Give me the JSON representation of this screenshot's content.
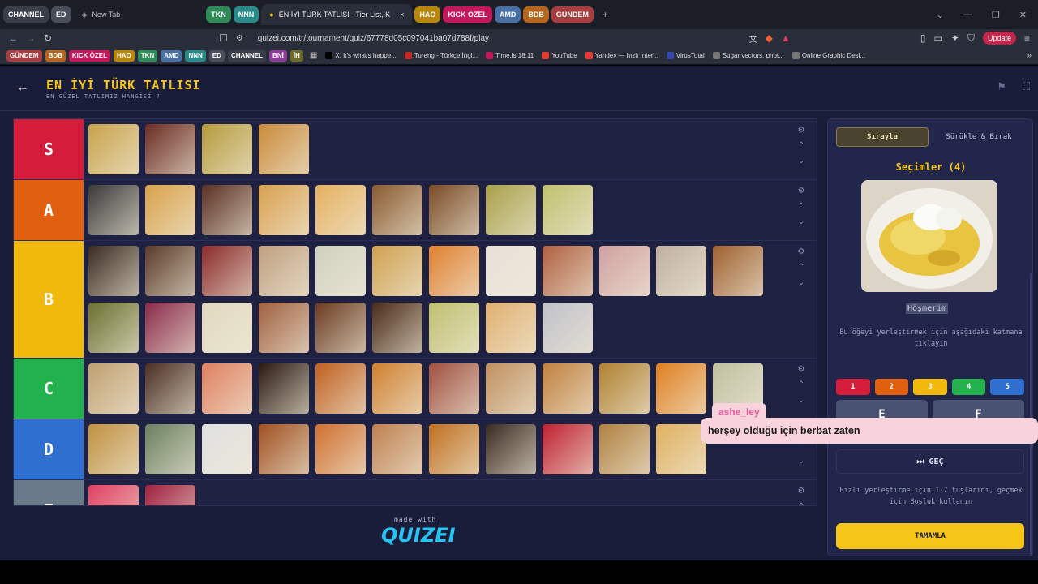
{
  "browser": {
    "tab_groups_left": [
      {
        "label": "CHANNEL",
        "color": "#3a3d4a"
      },
      {
        "label": "ED",
        "color": "#4a4d5a"
      }
    ],
    "new_tab_label": "New Tab",
    "tab_groups_mid": [
      {
        "label": "TKN",
        "color": "#2e8b57"
      },
      {
        "label": "NNN",
        "color": "#2a8a8a"
      }
    ],
    "active_tab": "EN İYİ TÜRK TATLISI - Tier List, K",
    "tab_groups_right": [
      {
        "label": "HAO",
        "color": "#b8860b"
      },
      {
        "label": "KICK ÖZEL",
        "color": "#c2185b"
      },
      {
        "label": "AMD",
        "color": "#4a6fa5"
      },
      {
        "label": "BDB",
        "color": "#b5651d"
      },
      {
        "label": "GÜNDEM",
        "color": "#a63d40"
      }
    ],
    "url": "quizei.com/tr/tournament/quiz/67778d05c097041ba07d788f/play",
    "update_label": "Update",
    "bookmark_chips": [
      {
        "label": "GÜNDEM",
        "color": "#a63d40"
      },
      {
        "label": "BDB",
        "color": "#b5651d"
      },
      {
        "label": "KICK ÖZEL",
        "color": "#c2185b"
      },
      {
        "label": "HAO",
        "color": "#b8860b"
      },
      {
        "label": "TKN",
        "color": "#2e8b57"
      },
      {
        "label": "AMD",
        "color": "#4a6fa5"
      },
      {
        "label": "NNN",
        "color": "#2a8a8a"
      },
      {
        "label": "ED",
        "color": "#4a4d5a"
      },
      {
        "label": "CHANNEL",
        "color": "#3a3d4a"
      },
      {
        "label": "BNİ",
        "color": "#8e3a9a"
      },
      {
        "label": "İH",
        "color": "#6b6b2a"
      }
    ],
    "bookmarks": [
      {
        "label": "X. It's what's happe...",
        "color": "#000000"
      },
      {
        "label": "Tureng - Türkçe İngi...",
        "color": "#c62828"
      },
      {
        "label": "Time.is 18:11",
        "color": "#c2185b"
      },
      {
        "label": "YouTube",
        "color": "#e53935"
      },
      {
        "label": "Yandex — hızlı İnter...",
        "color": "#e53935"
      },
      {
        "label": "VirusTotal",
        "color": "#3949ab"
      },
      {
        "label": "Sugar vectors, phot...",
        "color": "#777777"
      },
      {
        "label": "Online Graphic Desi...",
        "color": "#777777"
      }
    ]
  },
  "quiz": {
    "title": "EN İYİ TÜRK TATLISI",
    "subtitle": "EN GÜZEL TATLIMIZ HANGİSİ ?",
    "made_with": "made with",
    "logo": "QUIZEI"
  },
  "tiers": [
    {
      "label": "S",
      "color": "#d51c3b",
      "items": [
        "#c8a24a",
        "#6b2c22",
        "#b59a3c",
        "#c98a3a"
      ]
    },
    {
      "label": "A",
      "color": "#e0600f",
      "items": [
        "#3a3a3a",
        "#d8a14a",
        "#5a2f22",
        "#d9a050",
        "#e5b060",
        "#8a5a30",
        "#7a4a25",
        "#a8a04a",
        "#c0c070"
      ]
    },
    {
      "label": "B",
      "color": "#f0b90b",
      "items": [
        "#3a2a20",
        "#5a3a28",
        "#8a2a2a",
        "#c0a080",
        "#d0d0c0",
        "#d0a050",
        "#e08030",
        "#e8e0d8",
        "#b06040",
        "#d0a0a0",
        "#c0b0a0",
        "#a06030",
        "#6a7030",
        "#8a2a4a",
        "#e0d8c0",
        "#a06040",
        "#6a3a20",
        "#4a2a18",
        "#c0c070",
        "#e0b070",
        "#c0c0c8"
      ]
    },
    {
      "label": "C",
      "color": "#22b14c",
      "items": [
        "#c0a070",
        "#4a2e24",
        "#e08060",
        "#2a1810",
        "#c06020",
        "#d08030",
        "#a05040",
        "#c09060",
        "#c08040",
        "#b08030",
        "#e08020",
        "#c0c0a0"
      ]
    },
    {
      "label": "D",
      "color": "#2f6fd0",
      "items": [
        "#c09040",
        "#6a8060",
        "#e0e0e0",
        "#a05020",
        "#d07030",
        "#c08050",
        "#c07020",
        "#3a2a20",
        "#c02030",
        "#b08040",
        "#e0b060"
      ]
    },
    {
      "label": "E",
      "color": "#6a7a8a",
      "items": [
        "#e04060",
        "#a02040"
      ]
    }
  ],
  "panel": {
    "mode_sequential": "Sırayla",
    "mode_drag": "Sürükle & Bırak",
    "selections_title": "Seçimler (4)",
    "item_name": "Höşmerim",
    "help_text": "Bu öğeyi yerleştirmek için aşağıdaki katmana tıklayın",
    "number_buttons": [
      {
        "label": "1",
        "color": "#d51c3b"
      },
      {
        "label": "2",
        "color": "#e0600f"
      },
      {
        "label": "3",
        "color": "#f0b90b"
      },
      {
        "label": "4",
        "color": "#22b14c"
      },
      {
        "label": "5",
        "color": "#2f6fd0"
      }
    ],
    "tier_e": {
      "label": "E",
      "key": "6"
    },
    "tier_f": {
      "label": "F",
      "key": "7"
    },
    "skip_label": "GEÇ",
    "hint": "Hızlı yerleştirme için 1-7 tuşlarını, geçmek için Boşluk kullanın",
    "finish_label": "TAMAMLA"
  },
  "chat": {
    "user": "ashe_ley",
    "message": "herşey olduğu için berbat zaten"
  }
}
